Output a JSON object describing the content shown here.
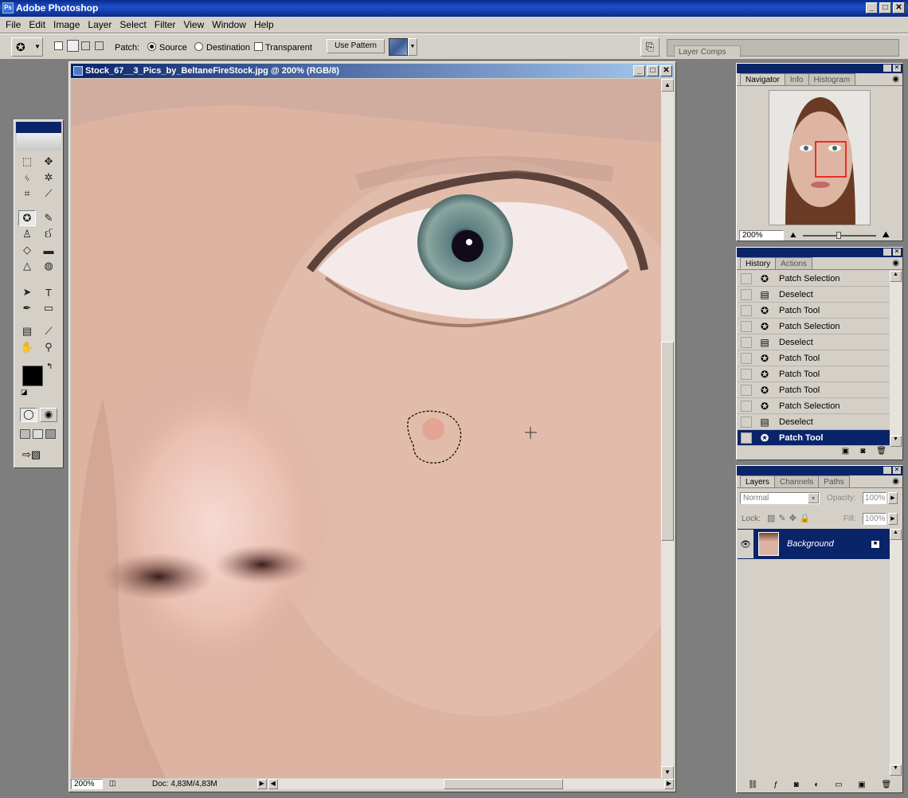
{
  "app": {
    "title": "Adobe Photoshop",
    "logo_text": "Ps"
  },
  "window_buttons": [
    "_",
    "□",
    "✕"
  ],
  "menu": [
    "File",
    "Edit",
    "Image",
    "Layer",
    "Select",
    "Filter",
    "View",
    "Window",
    "Help"
  ],
  "options_bar": {
    "patch_label": "Patch:",
    "source_label": "Source",
    "destination_label": "Destination",
    "transparent_label": "Transparent",
    "use_pattern_label": "Use Pattern",
    "layer_comps_label": "Layer Comps",
    "patch_mode": "Source"
  },
  "document": {
    "title": "Stock_67__3_Pics_by_BeltaneFireStock.jpg @ 200% (RGB/8)",
    "zoom": "200%",
    "doc_size": "Doc: 4,83M/4,83M"
  },
  "navigator": {
    "tabs": [
      "Navigator",
      "Info",
      "Histogram"
    ],
    "zoom": "200%"
  },
  "history": {
    "tabs": [
      "History",
      "Actions"
    ],
    "items": [
      {
        "label": "Patch Selection",
        "icon": "patch-icon"
      },
      {
        "label": "Deselect",
        "icon": "document-icon"
      },
      {
        "label": "Patch Tool",
        "icon": "patch-icon"
      },
      {
        "label": "Patch Selection",
        "icon": "patch-icon"
      },
      {
        "label": "Deselect",
        "icon": "document-icon"
      },
      {
        "label": "Patch Tool",
        "icon": "patch-icon"
      },
      {
        "label": "Patch Tool",
        "icon": "patch-icon"
      },
      {
        "label": "Patch Tool",
        "icon": "patch-icon"
      },
      {
        "label": "Patch Selection",
        "icon": "patch-icon"
      },
      {
        "label": "Deselect",
        "icon": "document-icon"
      },
      {
        "label": "Patch Tool",
        "icon": "patch-icon",
        "selected": true
      }
    ]
  },
  "layers": {
    "tabs": [
      "Layers",
      "Channels",
      "Paths"
    ],
    "blend_mode": "Normal",
    "opacity_label": "Opacity:",
    "opacity": "100%",
    "lock_label": "Lock:",
    "fill_label": "Fill:",
    "fill": "100%",
    "items": [
      {
        "name": "Background",
        "visible": true,
        "selected": true
      }
    ]
  },
  "colors": {
    "titlebar": "#0a246a",
    "chrome": "#d4d0c8",
    "selection": "#0a246a"
  }
}
